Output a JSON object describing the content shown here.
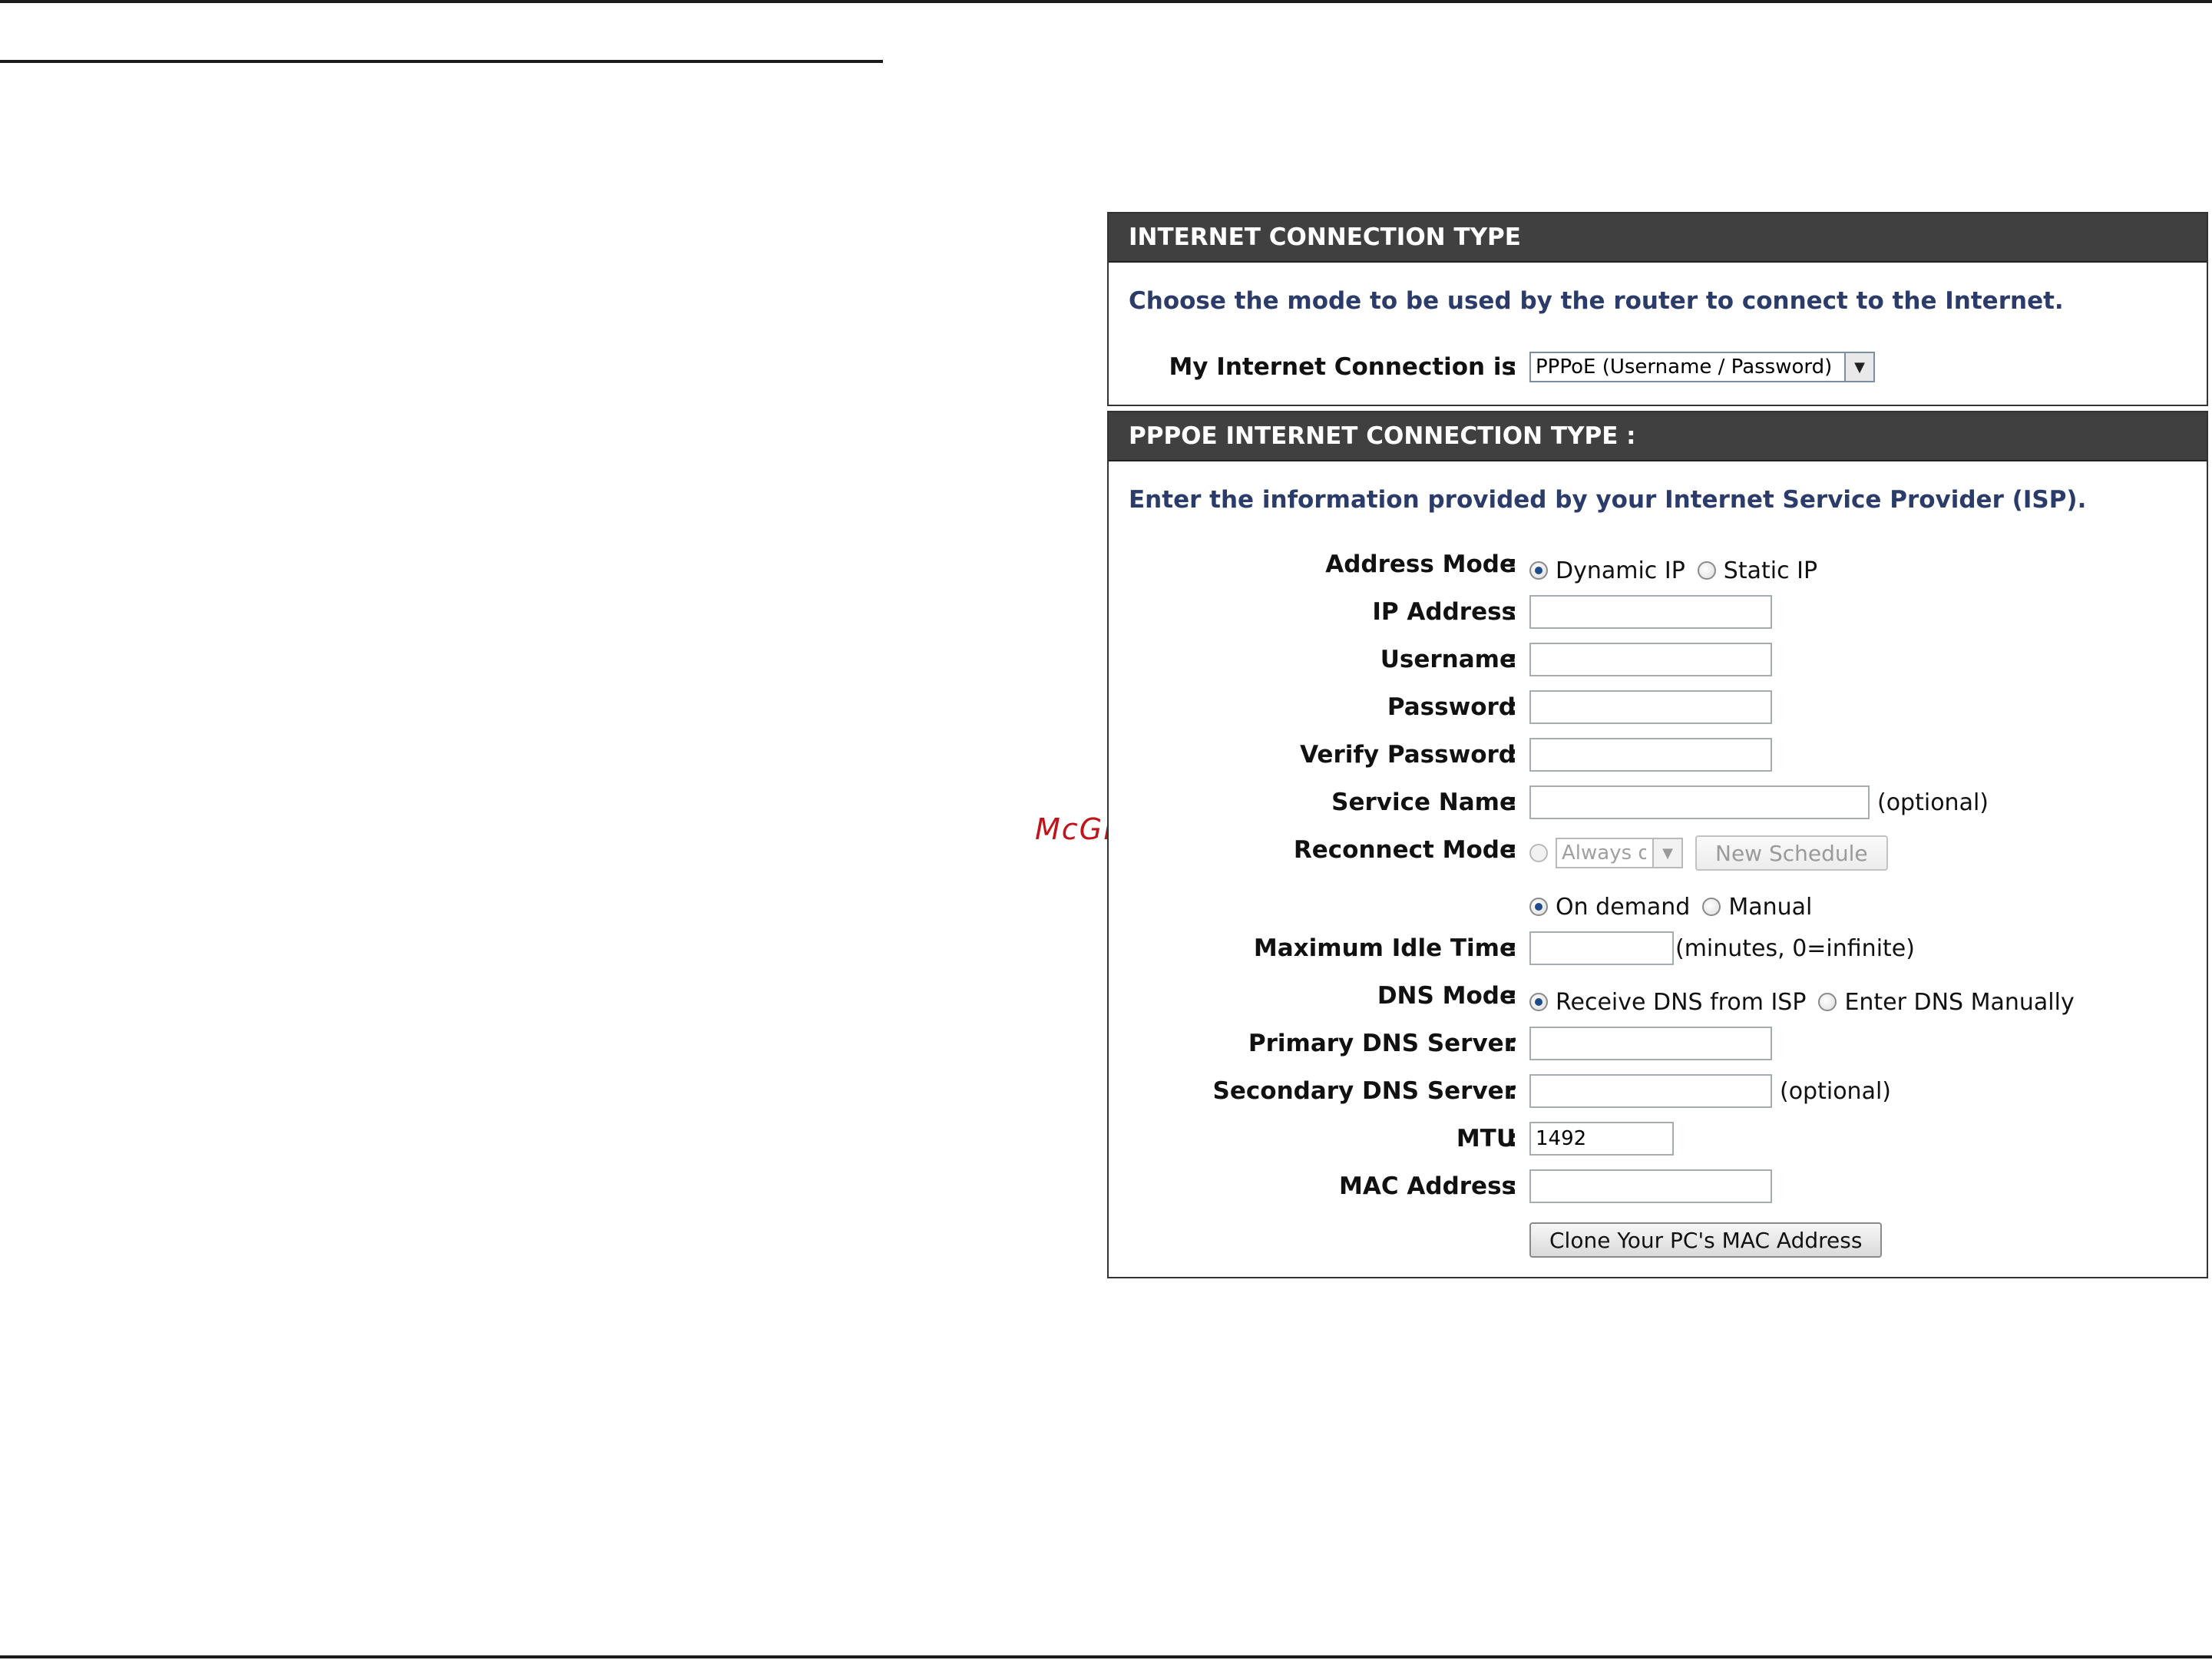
{
  "watermark": "McGrp.Ru",
  "internet_connection_type": {
    "header": "INTERNET CONNECTION TYPE",
    "description": "Choose the mode to be used by the router to connect to the Internet.",
    "connection_label": "My Internet Connection is",
    "connection_value": "PPPoE (Username / Password)"
  },
  "pppoe": {
    "header": "PPPOE INTERNET CONNECTION TYPE :",
    "description": "Enter the information provided by your Internet Service Provider (ISP).",
    "address_mode": {
      "label": "Address Mode",
      "options": [
        "Dynamic IP",
        "Static IP"
      ],
      "selected": "Dynamic IP"
    },
    "ip_address": {
      "label": "IP Address",
      "value": ""
    },
    "username": {
      "label": "Username",
      "value": ""
    },
    "password": {
      "label": "Password",
      "value": ""
    },
    "verify_password": {
      "label": "Verify Password",
      "value": ""
    },
    "service_name": {
      "label": "Service Name",
      "value": "",
      "note": "(optional)"
    },
    "reconnect_mode": {
      "label": "Reconnect Mode",
      "schedule_value": "Always o",
      "new_schedule_button": "New Schedule",
      "options": [
        "On demand",
        "Manual"
      ],
      "selected": "On demand"
    },
    "max_idle_time": {
      "label": "Maximum Idle Time",
      "value": "",
      "note": "(minutes, 0=infinite)"
    },
    "dns_mode": {
      "label": "DNS Mode",
      "options": [
        "Receive DNS from ISP",
        "Enter DNS Manually"
      ],
      "selected": "Receive DNS from ISP"
    },
    "primary_dns": {
      "label": "Primary DNS Server",
      "value": ""
    },
    "secondary_dns": {
      "label": "Secondary DNS Server",
      "value": "",
      "note": "(optional)"
    },
    "mtu": {
      "label": "MTU",
      "value": "1492"
    },
    "mac_address": {
      "label": "MAC Address",
      "value": ""
    },
    "clone_mac_button": "Clone Your PC's MAC Address",
    "colon": ":"
  }
}
